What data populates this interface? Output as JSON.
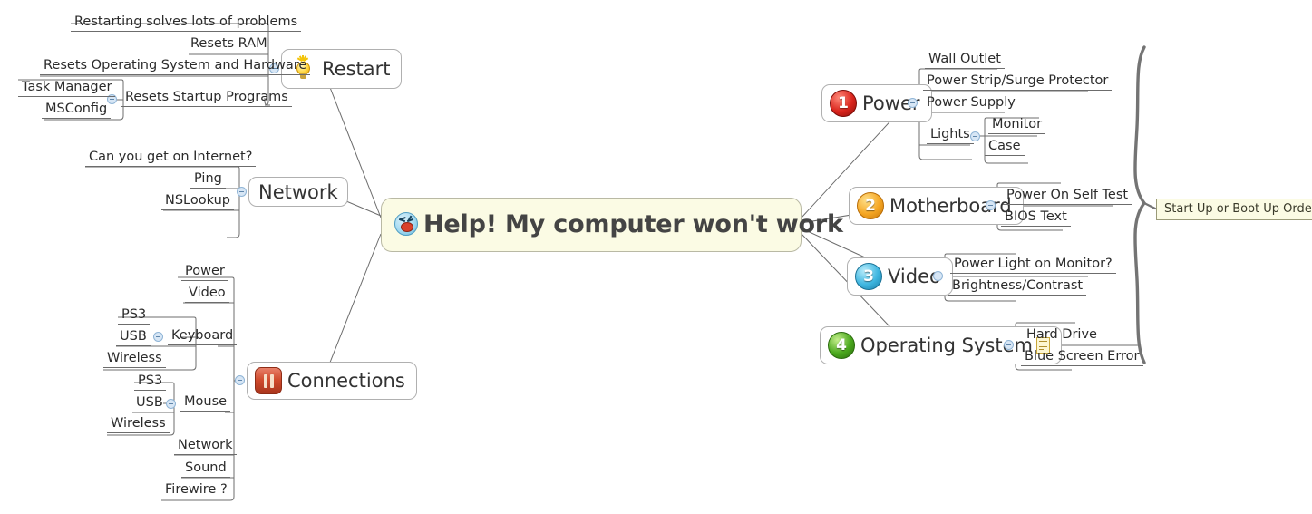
{
  "diagram": {
    "type": "mind-map",
    "center": {
      "label": "Help! My computer won't work",
      "icon": "angry-face-icon"
    },
    "boundary": {
      "label": "Start Up or Boot Up Order",
      "covers": [
        "Power",
        "Motherboard",
        "Video",
        "Operating System"
      ]
    },
    "branches": [
      {
        "id": "restart",
        "label": "Restart",
        "icon": "lightbulb-icon",
        "side": "left",
        "children": [
          {
            "label": "Restarting solves lots of problems"
          },
          {
            "label": "Resets RAM"
          },
          {
            "label": "Resets Operating System and Hardware"
          },
          {
            "label": "Resets Startup Programs",
            "collapsible": true,
            "children": [
              {
                "label": "Task Manager"
              },
              {
                "label": "MSConfig"
              }
            ]
          }
        ]
      },
      {
        "id": "network",
        "label": "Network",
        "icon": "none",
        "side": "left",
        "children": [
          {
            "label": "Can you get on Internet?"
          },
          {
            "label": "Ping"
          },
          {
            "label": "NSLookup"
          }
        ]
      },
      {
        "id": "connections",
        "label": "Connections",
        "icon": "pause-icon",
        "side": "left",
        "children": [
          {
            "label": "Power"
          },
          {
            "label": "Video"
          },
          {
            "label": "Keyboard",
            "collapsible": true,
            "children": [
              {
                "label": "PS3"
              },
              {
                "label": "USB"
              },
              {
                "label": "Wireless"
              }
            ]
          },
          {
            "label": "Mouse",
            "collapsible": true,
            "children": [
              {
                "label": "PS3"
              },
              {
                "label": "USB"
              },
              {
                "label": "Wireless"
              }
            ]
          },
          {
            "label": "Network"
          },
          {
            "label": "Sound"
          },
          {
            "label": "Firewire ?"
          }
        ]
      },
      {
        "id": "power",
        "label": "Power",
        "icon": "number-1-icon",
        "side": "right",
        "children": [
          {
            "label": "Wall Outlet"
          },
          {
            "label": "Power Strip/Surge Protector"
          },
          {
            "label": "Power Supply"
          },
          {
            "label": "Lights",
            "collapsible": true,
            "children": [
              {
                "label": "Monitor"
              },
              {
                "label": "Case"
              }
            ]
          }
        ]
      },
      {
        "id": "motherboard",
        "label": "Motherboard",
        "icon": "number-2-icon",
        "side": "right",
        "children": [
          {
            "label": "Power On Self Test"
          },
          {
            "label": "BIOS Text"
          }
        ]
      },
      {
        "id": "video",
        "label": "Video",
        "icon": "number-3-icon",
        "side": "right",
        "children": [
          {
            "label": "Power Light on Monitor?"
          },
          {
            "label": "Brightness/Contrast"
          }
        ]
      },
      {
        "id": "operating-system",
        "label": "Operating System",
        "icon": "number-4-icon",
        "note_icon": "note-icon",
        "side": "right",
        "children": [
          {
            "label": "Hard Drive"
          },
          {
            "label": "Blue Screen Error"
          }
        ]
      }
    ],
    "icon_numbers": {
      "power": "1",
      "motherboard": "2",
      "video": "3",
      "operating_system": "4"
    },
    "colors": {
      "center_fill": "#fbfbe4",
      "center_border": "#b9b9a4",
      "node_fill": "#ffffff",
      "node_border": "#b0b0b0",
      "line": "#6c6c6c",
      "toggle_fill": "#d7e6f5",
      "toggle_border": "#8fb4d6",
      "boundary_fill": "#fbfbe4",
      "boundary_border": "#9a9a78",
      "num1": "#d9241c",
      "num2": "#f5a623",
      "num3": "#3fb6e0",
      "num4": "#4aa81d",
      "pause": "#cf4a2c",
      "bulb": "#ffd741"
    }
  }
}
